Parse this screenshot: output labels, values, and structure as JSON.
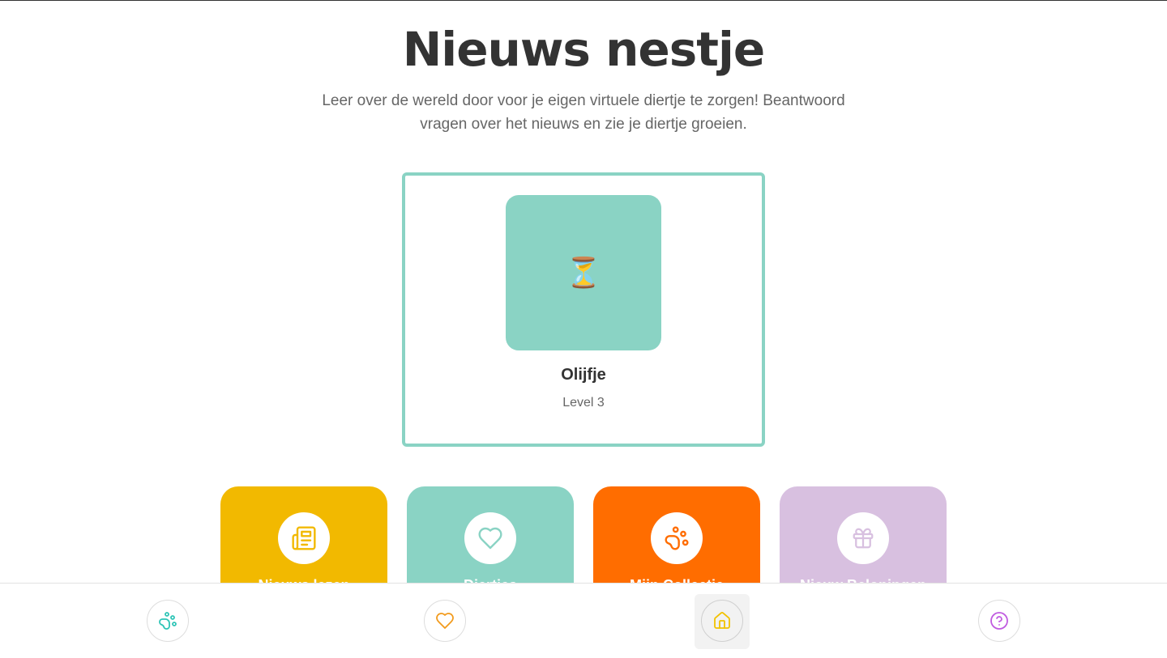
{
  "page": {
    "title": "Nieuws nestje",
    "subtitle": "Leer over de wereld door voor je eigen virtuele diertje te zorgen! Beantwoord vragen over het nieuws en zie je diertje groeien."
  },
  "pet": {
    "name": "Olijfje",
    "level": "Level 3",
    "icon": "hourglass-icon",
    "emoji": "⏳",
    "color": "#8ad3c4"
  },
  "actions": [
    {
      "label": "Nieuws lezen",
      "icon": "newspaper-icon",
      "color": "#f2b900"
    },
    {
      "label": "Diertjes",
      "icon": "heart-icon",
      "color": "#8ad3c4"
    },
    {
      "label": "Mijn Collectie",
      "icon": "paw-icon",
      "color": "#ff6d00"
    },
    {
      "label": "Nieuw Beloningen",
      "icon": "gift-icon",
      "color": "#d8c0e0"
    }
  ],
  "nav": {
    "items": [
      {
        "icon": "paw-icon",
        "color": "#2ec4b6",
        "active": false
      },
      {
        "icon": "heart-icon",
        "color": "#f29b1d",
        "active": false
      },
      {
        "icon": "home-icon",
        "color": "#f2c200",
        "active": true
      },
      {
        "icon": "help-icon",
        "color": "#c05be0",
        "active": false
      }
    ]
  }
}
